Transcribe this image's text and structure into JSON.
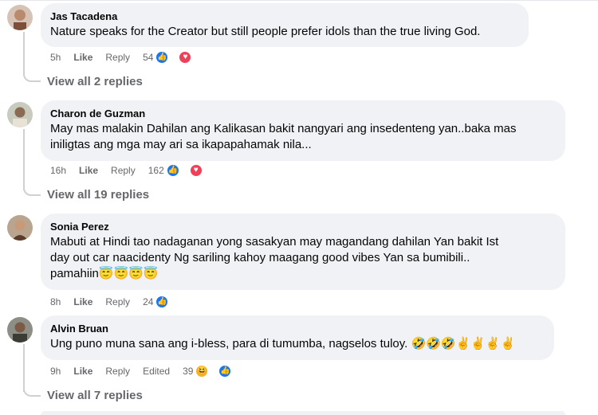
{
  "comments": [
    {
      "author": "Jas Tacadena",
      "text": "Nature speaks for the Creator but still people prefer idols than the true living God.",
      "time": "5h",
      "like": "Like",
      "reply": "Reply",
      "reaction_count": "54",
      "view_replies": "View all 2 replies"
    },
    {
      "author": "Charon de Guzman",
      "text_line1": "May mas malakin Dahilan ang Kalikasan bakit nangyari ang insedenteng yan..baka mas",
      "text_line2": "iniligtas ang mga may ari sa ikapapahamak nila...",
      "time": "16h",
      "like": "Like",
      "reply": "Reply",
      "reaction_count": "162",
      "view_replies": "View all 19 replies"
    },
    {
      "author": "Sonia Perez",
      "text_line1": "Mabuti at Hindi tao nadaganan yong sasakyan may magandang dahilan Yan bakit Ist",
      "text_line2": "day out car naacidenty Ng sariling kahoy maagang good vibes Yan sa bumibili..",
      "text_line3": "pamahiin😇😇😇😇",
      "time": "8h",
      "like": "Like",
      "reply": "Reply",
      "reaction_count": "24"
    },
    {
      "author": "Alvin Bruan",
      "text": "Ung puno muna sana ang i-bless, para di tumumba, nagselos tuloy. 🤣🤣🤣✌✌✌✌",
      "time": "9h",
      "like": "Like",
      "reply": "Reply",
      "edited": "Edited",
      "reaction_count": "39",
      "view_replies": "View all 7 replies"
    }
  ],
  "icons": {
    "like": "thumbs-up-icon",
    "love": "heart-icon",
    "haha": "laughing-face-icon"
  },
  "colors": {
    "bubble": "#f0f2f5",
    "meta_text": "#65676b",
    "like_blue": "#1877f2",
    "love_red": "#f33e58",
    "haha_yellow": "#f7b125"
  }
}
